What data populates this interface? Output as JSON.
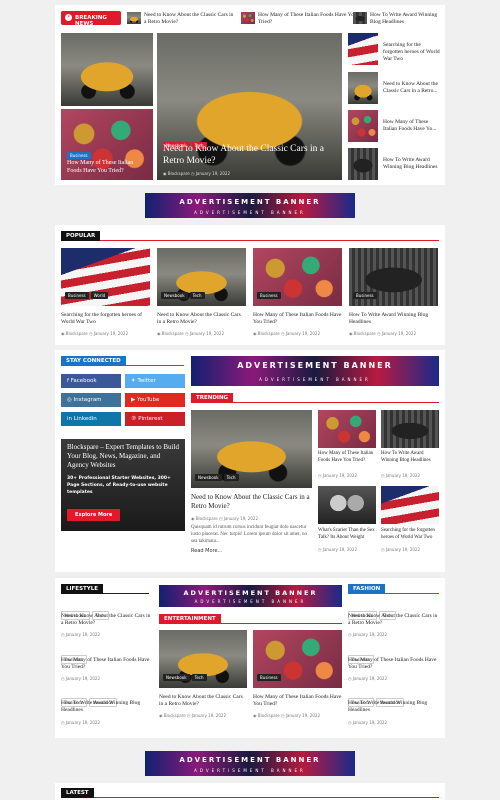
{
  "breaking": {
    "label": "BREAKING NEWS",
    "items": [
      "Need to Know About the Classic Cars in a Retro Movie?",
      "How Many of These Italian Foods Have You Tried?",
      "How To Write Award Winning Blog Headlines"
    ]
  },
  "hero": {
    "main": {
      "tags": [
        "Newsbook",
        "Tech"
      ],
      "title": "Need to Know About the Classic Cars in a Retro Movie?",
      "author": "Blockspare",
      "date": "January 19, 2022"
    },
    "left_bottom": {
      "tag": "Business",
      "title": "How Many of These Italian Foods Have You Tried?"
    },
    "side": [
      "Searching for the forgotten heroes of World War Two",
      "Need to Know About the Classic Cars in a Retro...",
      "How Many of These Italian Foods Have Yo...",
      "How To Write Award Winning Blog Headlines"
    ]
  },
  "ad": {
    "title": "ADVERTISEMENT BANNER",
    "sub": "ADVERTISEMENT BANNER"
  },
  "popular": {
    "label": "POPULAR",
    "items": [
      {
        "tags": [
          "Business",
          "World"
        ],
        "title": "Searching for the forgotten heroes of World War Two",
        "author": "Blockspare",
        "date": "January 19, 2022"
      },
      {
        "tags": [
          "Newsbook",
          "Tech"
        ],
        "title": "Need to Know About the Classic Cars in a Retro Movie?",
        "author": "Blockspare",
        "date": "January 19, 2022"
      },
      {
        "tags": [
          "Business"
        ],
        "title": "How Many of These Italian Foods Have You Tried?",
        "author": "Blockspare",
        "date": "January 19, 2022"
      },
      {
        "tags": [
          "Business"
        ],
        "title": "How To Write Award Winning Blog Headlines",
        "author": "Blockspare",
        "date": "January 19, 2022"
      }
    ]
  },
  "social": {
    "label": "STAY CONNECTED",
    "items": [
      "Facebook",
      "Twitter",
      "Instagram",
      "YouTube",
      "Linkedin",
      "Pinterest"
    ]
  },
  "promo": {
    "title": "Blockspare – Expert Templates to Build Your Blog, News, Magazine, and Agency Websites",
    "sub": "30+ Professional Starter Websites, 300+ Page Sections, of Ready-to-use website templates",
    "button": "Explore More"
  },
  "trending": {
    "label": "TRENDING",
    "main": {
      "tags": [
        "Newsbook",
        "Tech"
      ],
      "title": "Need to Know About the Classic Cars in a Retro Movie?",
      "author": "Blockspare",
      "date": "January 19, 2022",
      "excerpt": "Quisquam id rutrum cursus incidunt feugiat dolo nascetur iusto placerat. Nec turpis! Lorem ipsum dolor sit amet, no sea takimata...",
      "more": "Read More..."
    },
    "items": [
      {
        "title": "How Many of These Italian Foods Have You Tried?",
        "date": "January 19, 2022"
      },
      {
        "title": "How To Write Award Winning Blog Headlines",
        "date": "January 19, 2022"
      },
      {
        "title": "What's Scarier Than the Sex Talk? Its About Weight",
        "date": "January 19, 2022"
      },
      {
        "title": "Searching for the forgotten heroes of World War Two",
        "date": "January 19, 2022"
      }
    ]
  },
  "lifestyle": {
    "label": "LIFESTYLE",
    "items": [
      {
        "tags": [
          "Newsbook",
          "Tech"
        ],
        "title": "Need to Know About the Classic Cars in a Retro Movie?",
        "date": "January 19, 2022"
      },
      {
        "tags": [
          "Business"
        ],
        "title": "How Many of These Italian Foods Have You Tried?",
        "date": "January 19, 2022"
      },
      {
        "tags": [
          "Business",
          "Newsbook"
        ],
        "title": "How To Write Award Winning Blog Headlines",
        "date": "January 19, 2022"
      }
    ]
  },
  "entertainment": {
    "label": "ENTERTAINMENT",
    "items": [
      {
        "tags": [
          "Newsbook",
          "Tech"
        ],
        "title": "Need to Know About the Classic Cars in a Retro Movie?",
        "author": "Blockspare",
        "date": "January 19, 2022"
      },
      {
        "tags": [
          "Business"
        ],
        "title": "How Many of These Italian Foods Have You Tried?",
        "author": "Blockspare",
        "date": "January 19, 2022"
      }
    ]
  },
  "fashion": {
    "label": "FASHION",
    "items": [
      {
        "tags": [
          "Newsbook",
          "Tech"
        ],
        "title": "Need to Know About the Classic Cars in a Retro Movie?",
        "date": "January 19, 2022"
      },
      {
        "tags": [
          "Business"
        ],
        "title": "How Many of These Italian Foods Have You Tried?",
        "date": "January 19, 2022"
      },
      {
        "tags": [
          "Business",
          "Newsbook"
        ],
        "title": "How To Write Award Winning Blog Headlines",
        "date": "January 19, 2022"
      }
    ]
  },
  "latest": {
    "label": "LATEST"
  },
  "colors": {
    "accent": "#e01a2b",
    "blue": "#1a73c7"
  }
}
